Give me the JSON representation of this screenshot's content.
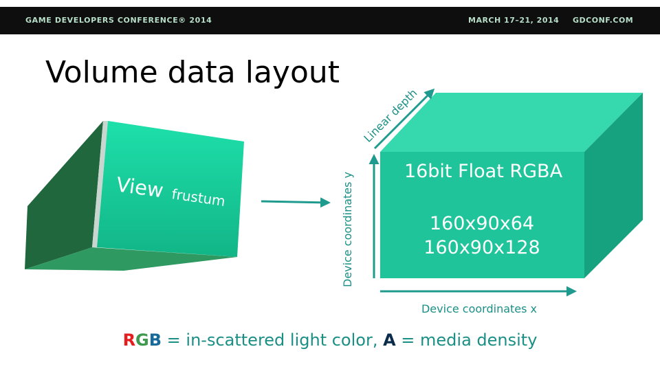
{
  "colors": {
    "topbar_bg": "#0e0e0e",
    "topbar_text": "#b7dfc9",
    "title": "#000000",
    "teal": "#25b89a",
    "teal_text": "#1b8f86",
    "r": "#e41e1e",
    "g": "#3e9a4f",
    "b": "#176a9a",
    "a": "#0a2b4a",
    "frustum_front_top": "#1ee0aa",
    "frustum_front_bottom": "#12b587",
    "frustum_side_dark": "#20673e",
    "frustum_side": "#2f8a55",
    "frustum_bottom": "#2e9a62",
    "box_front": "#20c49a",
    "box_top": "#36d8ae",
    "box_side": "#17a27f",
    "arrow": "#1e9a8e"
  },
  "header": {
    "conference": "GAME DEVELOPERS CONFERENCE® 2014",
    "dates": "MARCH 17–21, 2014",
    "site": "GDCONF.COM"
  },
  "slide": {
    "title": "Volume data layout"
  },
  "frustum": {
    "label_view": "View",
    "label_frustum": "frustum"
  },
  "volume_box": {
    "format": "16bit Float RGBA",
    "size_1": "160x90x64",
    "size_2": "160x90x128"
  },
  "axes": {
    "depth": "Linear depth",
    "y": "Device coordinates y",
    "x": "Device coordinates x"
  },
  "caption": {
    "r": "R",
    "g": "G",
    "b": "B",
    "rgb_desc": " = in-scattered light color, ",
    "a": "A",
    "a_desc": " = media density"
  }
}
